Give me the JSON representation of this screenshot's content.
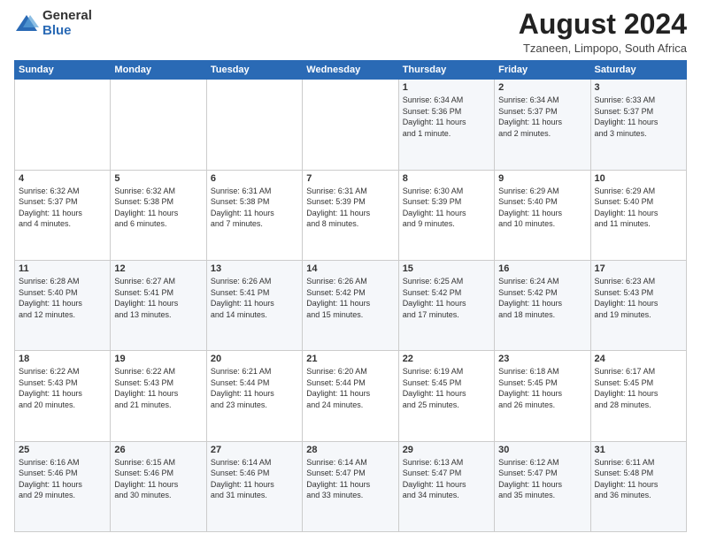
{
  "logo": {
    "general": "General",
    "blue": "Blue"
  },
  "title": "August 2024",
  "subtitle": "Tzaneen, Limpopo, South Africa",
  "days_header": [
    "Sunday",
    "Monday",
    "Tuesday",
    "Wednesday",
    "Thursday",
    "Friday",
    "Saturday"
  ],
  "weeks": [
    [
      {
        "day": "",
        "info": ""
      },
      {
        "day": "",
        "info": ""
      },
      {
        "day": "",
        "info": ""
      },
      {
        "day": "",
        "info": ""
      },
      {
        "day": "1",
        "info": "Sunrise: 6:34 AM\nSunset: 5:36 PM\nDaylight: 11 hours\nand 1 minute."
      },
      {
        "day": "2",
        "info": "Sunrise: 6:34 AM\nSunset: 5:37 PM\nDaylight: 11 hours\nand 2 minutes."
      },
      {
        "day": "3",
        "info": "Sunrise: 6:33 AM\nSunset: 5:37 PM\nDaylight: 11 hours\nand 3 minutes."
      }
    ],
    [
      {
        "day": "4",
        "info": "Sunrise: 6:32 AM\nSunset: 5:37 PM\nDaylight: 11 hours\nand 4 minutes."
      },
      {
        "day": "5",
        "info": "Sunrise: 6:32 AM\nSunset: 5:38 PM\nDaylight: 11 hours\nand 6 minutes."
      },
      {
        "day": "6",
        "info": "Sunrise: 6:31 AM\nSunset: 5:38 PM\nDaylight: 11 hours\nand 7 minutes."
      },
      {
        "day": "7",
        "info": "Sunrise: 6:31 AM\nSunset: 5:39 PM\nDaylight: 11 hours\nand 8 minutes."
      },
      {
        "day": "8",
        "info": "Sunrise: 6:30 AM\nSunset: 5:39 PM\nDaylight: 11 hours\nand 9 minutes."
      },
      {
        "day": "9",
        "info": "Sunrise: 6:29 AM\nSunset: 5:40 PM\nDaylight: 11 hours\nand 10 minutes."
      },
      {
        "day": "10",
        "info": "Sunrise: 6:29 AM\nSunset: 5:40 PM\nDaylight: 11 hours\nand 11 minutes."
      }
    ],
    [
      {
        "day": "11",
        "info": "Sunrise: 6:28 AM\nSunset: 5:40 PM\nDaylight: 11 hours\nand 12 minutes."
      },
      {
        "day": "12",
        "info": "Sunrise: 6:27 AM\nSunset: 5:41 PM\nDaylight: 11 hours\nand 13 minutes."
      },
      {
        "day": "13",
        "info": "Sunrise: 6:26 AM\nSunset: 5:41 PM\nDaylight: 11 hours\nand 14 minutes."
      },
      {
        "day": "14",
        "info": "Sunrise: 6:26 AM\nSunset: 5:42 PM\nDaylight: 11 hours\nand 15 minutes."
      },
      {
        "day": "15",
        "info": "Sunrise: 6:25 AM\nSunset: 5:42 PM\nDaylight: 11 hours\nand 17 minutes."
      },
      {
        "day": "16",
        "info": "Sunrise: 6:24 AM\nSunset: 5:42 PM\nDaylight: 11 hours\nand 18 minutes."
      },
      {
        "day": "17",
        "info": "Sunrise: 6:23 AM\nSunset: 5:43 PM\nDaylight: 11 hours\nand 19 minutes."
      }
    ],
    [
      {
        "day": "18",
        "info": "Sunrise: 6:22 AM\nSunset: 5:43 PM\nDaylight: 11 hours\nand 20 minutes."
      },
      {
        "day": "19",
        "info": "Sunrise: 6:22 AM\nSunset: 5:43 PM\nDaylight: 11 hours\nand 21 minutes."
      },
      {
        "day": "20",
        "info": "Sunrise: 6:21 AM\nSunset: 5:44 PM\nDaylight: 11 hours\nand 23 minutes."
      },
      {
        "day": "21",
        "info": "Sunrise: 6:20 AM\nSunset: 5:44 PM\nDaylight: 11 hours\nand 24 minutes."
      },
      {
        "day": "22",
        "info": "Sunrise: 6:19 AM\nSunset: 5:45 PM\nDaylight: 11 hours\nand 25 minutes."
      },
      {
        "day": "23",
        "info": "Sunrise: 6:18 AM\nSunset: 5:45 PM\nDaylight: 11 hours\nand 26 minutes."
      },
      {
        "day": "24",
        "info": "Sunrise: 6:17 AM\nSunset: 5:45 PM\nDaylight: 11 hours\nand 28 minutes."
      }
    ],
    [
      {
        "day": "25",
        "info": "Sunrise: 6:16 AM\nSunset: 5:46 PM\nDaylight: 11 hours\nand 29 minutes."
      },
      {
        "day": "26",
        "info": "Sunrise: 6:15 AM\nSunset: 5:46 PM\nDaylight: 11 hours\nand 30 minutes."
      },
      {
        "day": "27",
        "info": "Sunrise: 6:14 AM\nSunset: 5:46 PM\nDaylight: 11 hours\nand 31 minutes."
      },
      {
        "day": "28",
        "info": "Sunrise: 6:14 AM\nSunset: 5:47 PM\nDaylight: 11 hours\nand 33 minutes."
      },
      {
        "day": "29",
        "info": "Sunrise: 6:13 AM\nSunset: 5:47 PM\nDaylight: 11 hours\nand 34 minutes."
      },
      {
        "day": "30",
        "info": "Sunrise: 6:12 AM\nSunset: 5:47 PM\nDaylight: 11 hours\nand 35 minutes."
      },
      {
        "day": "31",
        "info": "Sunrise: 6:11 AM\nSunset: 5:48 PM\nDaylight: 11 hours\nand 36 minutes."
      }
    ]
  ]
}
